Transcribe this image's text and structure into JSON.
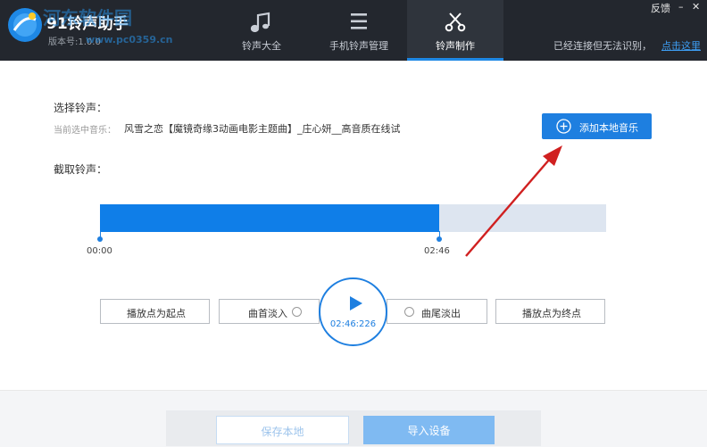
{
  "app": {
    "title": "91铃声助手",
    "version": "版本号:1.0.0",
    "watermark": "河东软件园",
    "watermark_url": "www.pc0359.cn"
  },
  "nav": {
    "tabs": [
      {
        "label": "铃声大全",
        "icon": "music-note-icon"
      },
      {
        "label": "手机铃声管理",
        "icon": "menu-list-icon"
      },
      {
        "label": "铃声制作",
        "icon": "scissors-icon",
        "active": true
      }
    ]
  },
  "window": {
    "feedback": "反馈",
    "minimize": "–",
    "close": "✕"
  },
  "status": {
    "connection_text": "已经连接但无法识别，",
    "connection_link": "点击这里"
  },
  "select": {
    "heading": "选择铃声：",
    "current_label": "当前选中音乐：",
    "current_value": "风雪之恋【魔镜奇缘3动画电影主题曲】_庄心妍__高音质在线试",
    "add_button": "添加本地音乐"
  },
  "cut": {
    "heading": "截取铃声：",
    "selection_fraction": 0.67,
    "start_time": "00:00",
    "end_time": "02:46",
    "set_start_button": "播放点为起点",
    "fade_in_label": "曲首淡入",
    "fade_out_label": "曲尾淡出",
    "set_end_button": "播放点为终点",
    "play_time": "02:46:226"
  },
  "footer": {
    "save_button": "保存本地",
    "import_button": "导入设备"
  },
  "colors": {
    "accent": "#1e7fe0",
    "topbar": "#23272e",
    "arrow": "#d02020"
  }
}
